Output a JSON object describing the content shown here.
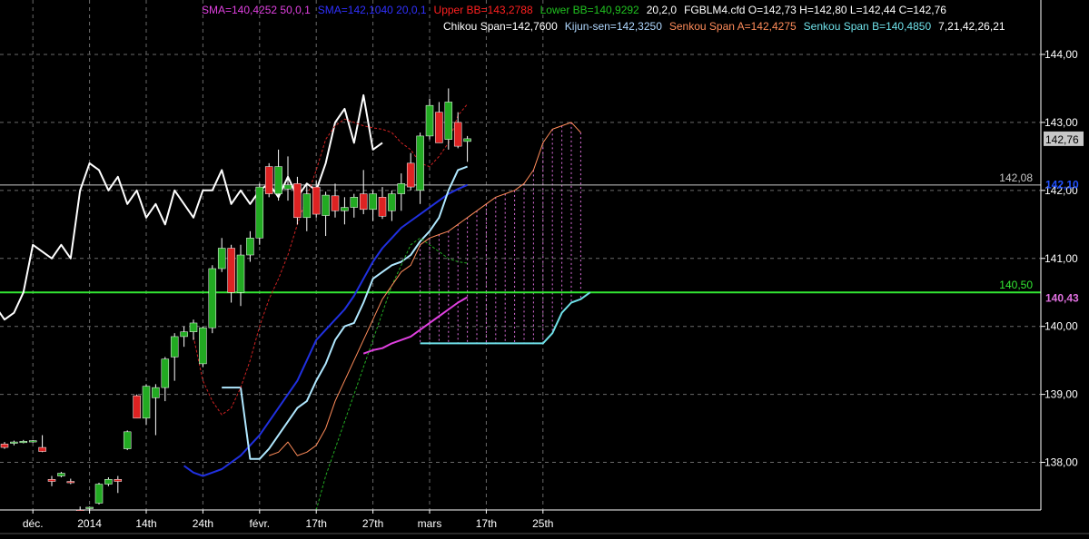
{
  "chart_data": {
    "type": "candlestick",
    "instrument": "FGBLM4.cfd",
    "ohlc": {
      "open": "142,73",
      "high": "142,80",
      "low": "142,44",
      "close": "142,76"
    },
    "ohlc_text": "FGBLM4.cfd O=142,73 H=142,80 L=142,44 C=142,76",
    "indicators": [
      {
        "text": "SMA=140,4252  50,0,1",
        "color": "#e040e0"
      },
      {
        "text": "SMA=142,1040  20,0,1",
        "color": "#3030ff"
      },
      {
        "text": "Upper BB=143,2788",
        "color": "#ff2020"
      },
      {
        "text": "Lower BB=140,9292",
        "color": "#20c020"
      },
      {
        "text": "20,2,0",
        "color": "#ffffff"
      },
      {
        "text": "Chikou Span=142,7600",
        "color": "#ffffff"
      },
      {
        "text": "Kijun-sen=142,3250",
        "color": "#b0d8ff"
      },
      {
        "text": "Senkou Span A=142,4275",
        "color": "#ff8c5a"
      },
      {
        "text": "Senkou Span B=140,4850",
        "color": "#6fe0e8"
      },
      {
        "text": "7,21,42,26,21",
        "color": "#ffffff"
      }
    ],
    "y_axis": {
      "range": [
        137.3,
        144.4
      ],
      "ticks": [
        138,
        139,
        140,
        141,
        142,
        143,
        144
      ],
      "tick_labels": [
        "138,00",
        "139,00",
        "140,00",
        "141,00",
        "142,00",
        "143,00",
        "144,00"
      ]
    },
    "x_axis": {
      "labels": [
        {
          "text": "déc.",
          "bar": 3
        },
        {
          "text": "2014",
          "bar": 9
        },
        {
          "text": "14th",
          "bar": 15
        },
        {
          "text": "24th",
          "bar": 21
        },
        {
          "text": "févr.",
          "bar": 27
        },
        {
          "text": "17th",
          "bar": 33
        },
        {
          "text": "27th",
          "bar": 39
        },
        {
          "text": "mars",
          "bar": 45
        },
        {
          "text": "17th",
          "bar": 51
        },
        {
          "text": "25th",
          "bar": 57
        }
      ]
    },
    "horizontal_lines": [
      {
        "value": 142.08,
        "label": "142,08",
        "color": "#c8c8c8"
      },
      {
        "value": 140.5,
        "label": "140,50",
        "color": "#33e633"
      }
    ],
    "price_badges": [
      {
        "value": 142.76,
        "label": "142,76",
        "color": "#000000",
        "bg": "#c8c8c8"
      },
      {
        "value": 142.1,
        "label": "142,10",
        "color": "#2050ff"
      },
      {
        "value": 140.43,
        "label": "140,43",
        "color": "#e070e0"
      }
    ],
    "colors": {
      "up": "#22aa22",
      "down": "#dd2222",
      "grid": "#6a6a6a"
    },
    "candles": [
      [
        138.27,
        138.3,
        138.2,
        138.22
      ],
      [
        138.28,
        138.32,
        138.25,
        138.3
      ],
      [
        138.3,
        138.33,
        138.28,
        138.31
      ],
      [
        138.31,
        138.33,
        138.29,
        138.32
      ],
      [
        138.22,
        138.4,
        138.15,
        138.16
      ],
      [
        137.75,
        137.8,
        137.65,
        137.72
      ],
      [
        137.8,
        137.86,
        137.78,
        137.84
      ],
      [
        137.72,
        137.76,
        137.68,
        137.7
      ],
      [
        137.3,
        137.35,
        137.25,
        137.28
      ],
      [
        137.32,
        137.35,
        137.28,
        137.34
      ],
      [
        137.4,
        137.7,
        137.38,
        137.68
      ],
      [
        137.68,
        137.78,
        137.65,
        137.75
      ],
      [
        137.75,
        137.8,
        137.55,
        137.72
      ],
      [
        138.2,
        138.47,
        138.18,
        138.45
      ],
      [
        138.98,
        139.0,
        138.65,
        138.65
      ],
      [
        138.65,
        139.15,
        138.55,
        139.12
      ],
      [
        138.95,
        139.15,
        138.4,
        139.1
      ],
      [
        139.1,
        139.55,
        138.9,
        139.52
      ],
      [
        139.55,
        139.9,
        139.2,
        139.85
      ],
      [
        139.85,
        140.0,
        139.7,
        139.92
      ],
      [
        139.92,
        140.1,
        139.8,
        140.05
      ],
      [
        139.45,
        140.0,
        139.4,
        139.98
      ],
      [
        139.98,
        140.9,
        139.9,
        140.85
      ],
      [
        140.85,
        141.3,
        140.8,
        141.15
      ],
      [
        141.15,
        141.2,
        140.35,
        140.5
      ],
      [
        140.5,
        141.2,
        140.3,
        141.05
      ],
      [
        141.05,
        141.4,
        140.95,
        141.3
      ],
      [
        141.3,
        142.1,
        141.2,
        142.05
      ],
      [
        142.35,
        142.4,
        141.9,
        141.95
      ],
      [
        141.95,
        142.6,
        141.85,
        142.35
      ],
      [
        142.02,
        142.5,
        141.85,
        142.08
      ],
      [
        142.1,
        142.2,
        141.5,
        141.6
      ],
      [
        141.6,
        142.1,
        141.4,
        141.95
      ],
      [
        142.05,
        142.15,
        141.6,
        141.65
      ],
      [
        141.63,
        141.98,
        141.33,
        141.93
      ],
      [
        141.92,
        142.1,
        141.6,
        141.7
      ],
      [
        141.7,
        141.9,
        141.5,
        141.75
      ],
      [
        141.75,
        141.95,
        141.6,
        141.9
      ],
      [
        141.95,
        142.3,
        141.65,
        141.72
      ],
      [
        141.72,
        142.0,
        141.55,
        141.95
      ],
      [
        141.9,
        142.05,
        141.58,
        141.62
      ],
      [
        141.7,
        142.0,
        141.55,
        141.95
      ],
      [
        141.95,
        142.25,
        141.7,
        142.1
      ],
      [
        142.4,
        142.55,
        142.0,
        142.05
      ],
      [
        142.0,
        142.85,
        141.8,
        142.8
      ],
      [
        142.8,
        143.35,
        142.75,
        143.25
      ],
      [
        143.15,
        143.3,
        142.7,
        142.7
      ],
      [
        142.75,
        143.5,
        142.6,
        143.3
      ],
      [
        143.0,
        143.15,
        142.62,
        142.65
      ],
      [
        142.72,
        142.8,
        142.42,
        142.76
      ]
    ],
    "lines": [
      {
        "name": "chikou",
        "color": "#ffffff",
        "width": 2,
        "dash": "",
        "values": [
          140.0,
          140.3,
          140.1,
          140.2,
          140.5,
          141.2,
          141.1,
          141.0,
          141.2,
          141.0,
          142.0,
          142.4,
          142.3,
          142.0,
          142.2,
          141.8,
          142.0,
          141.6,
          141.8,
          141.5,
          142.0,
          141.8,
          141.6,
          142.0,
          142.0,
          142.3,
          141.8,
          142.0,
          141.8,
          142.0,
          142.1,
          141.9,
          142.2,
          141.9,
          142.1,
          142.0,
          142.4,
          143.0,
          143.2,
          142.7,
          143.4,
          142.6,
          142.7
        ],
        "offset": -2
      },
      {
        "name": "sma50",
        "color": "#e040e0",
        "width": 2,
        "dash": "",
        "values": [
          139.6,
          139.65,
          139.68,
          139.75,
          139.8,
          139.85,
          139.95,
          140.05,
          140.15,
          140.25,
          140.35,
          140.43
        ],
        "offset": 38
      },
      {
        "name": "sma20",
        "color": "#2030e0",
        "width": 2,
        "dash": "",
        "values": [
          137.95,
          137.85,
          137.8,
          137.85,
          137.9,
          138.0,
          138.1,
          138.25,
          138.4,
          138.6,
          138.8,
          139.0,
          139.2,
          139.5,
          139.8,
          139.95,
          140.1,
          140.25,
          140.45,
          140.7,
          140.95,
          141.15,
          141.3,
          141.45,
          141.55,
          141.65,
          141.75,
          141.85,
          141.95,
          142.02,
          142.08
        ],
        "offset": 19
      },
      {
        "name": "kijun",
        "color": "#b0e8ff",
        "width": 2,
        "dash": "",
        "values": [
          139.1,
          139.1,
          139.1,
          138.05,
          138.05,
          138.2,
          138.4,
          138.6,
          138.8,
          138.9,
          139.2,
          139.45,
          139.8,
          140.0,
          140.05,
          140.35,
          140.7,
          140.8,
          140.9,
          140.95,
          141.05,
          141.25,
          141.4,
          141.6,
          142.0,
          142.3,
          142.35
        ],
        "offset": 23
      },
      {
        "name": "upper_bb",
        "color": "#cc2222",
        "width": 1,
        "dash": "3,2",
        "values": [
          139.85,
          139.2,
          138.9,
          138.7,
          138.8,
          139.1,
          139.5,
          140.0,
          140.4,
          140.7,
          141.05,
          141.5,
          141.9,
          142.3,
          142.75,
          142.95,
          143.05,
          143.0,
          142.95,
          142.92,
          142.9,
          142.85,
          142.7,
          142.6,
          142.4,
          142.35,
          142.5,
          142.7,
          143.1,
          143.27
        ],
        "offset": 20
      },
      {
        "name": "lower_bb",
        "color": "#22aa22",
        "width": 1,
        "dash": "3,2",
        "values": [
          137.3,
          137.8,
          138.2,
          138.6,
          139.0,
          139.4,
          139.8,
          140.2,
          140.6,
          140.9,
          141.2,
          141.3,
          141.2,
          141.1,
          141.0,
          140.95,
          140.93
        ],
        "offset": 33
      },
      {
        "name": "senkou_a",
        "color": "#ff8c5a",
        "width": 1,
        "dash": "",
        "values": [
          138.1,
          138.15,
          138.3,
          138.1,
          138.15,
          138.25,
          138.5,
          138.9,
          139.2,
          139.5,
          139.8,
          140.1,
          140.4,
          140.6,
          140.8,
          140.9,
          141.2,
          141.3,
          141.35,
          141.4,
          141.5,
          141.6,
          141.7,
          141.8,
          141.9,
          141.95,
          142.0,
          142.1,
          142.3,
          142.7,
          142.9,
          142.95,
          143.0,
          142.85
        ],
        "offset": 28
      },
      {
        "name": "senkou_b",
        "color": "#6fe0e8",
        "width": 2,
        "dash": "",
        "values": [
          139.75,
          139.75,
          139.75,
          139.75,
          139.75,
          139.75,
          139.75,
          139.75,
          139.75,
          139.75,
          139.75,
          139.75,
          139.75,
          139.75,
          139.9,
          140.2,
          140.35,
          140.4,
          140.5
        ],
        "offset": 44
      }
    ]
  }
}
